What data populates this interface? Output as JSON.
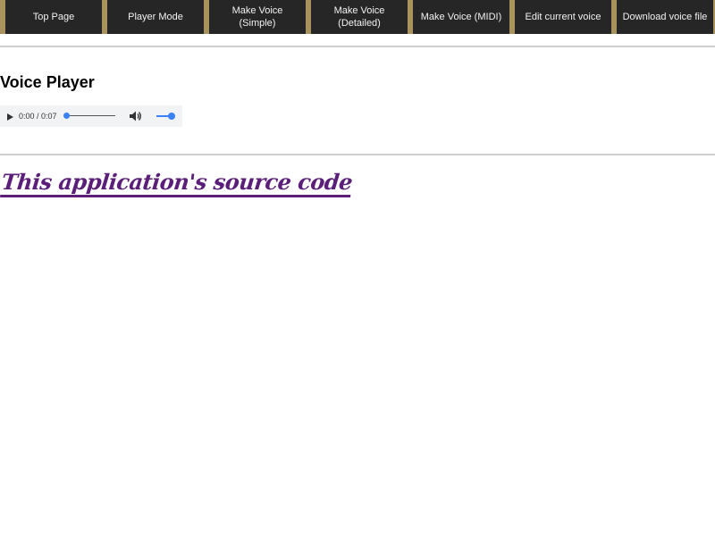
{
  "nav": {
    "items": [
      {
        "label": "Top Page"
      },
      {
        "label": "Player Mode"
      },
      {
        "label": "Make Voice (Simple)"
      },
      {
        "label_line1": "Make Voice",
        "label_line2": "(Detailed)"
      },
      {
        "label": "Make Voice (MIDI)"
      },
      {
        "label": "Edit current voice"
      },
      {
        "label": "Download voice file"
      }
    ]
  },
  "main": {
    "title": "Voice Player",
    "player": {
      "time": "0:00 / 0:07",
      "progress": 0,
      "volume": 1.0
    },
    "source_link": "This application's source code"
  },
  "colors": {
    "nav_bg": "#262626",
    "nav_separator": "#a8935f",
    "link": "#5b1f7a",
    "accent": "#3b82f6"
  }
}
